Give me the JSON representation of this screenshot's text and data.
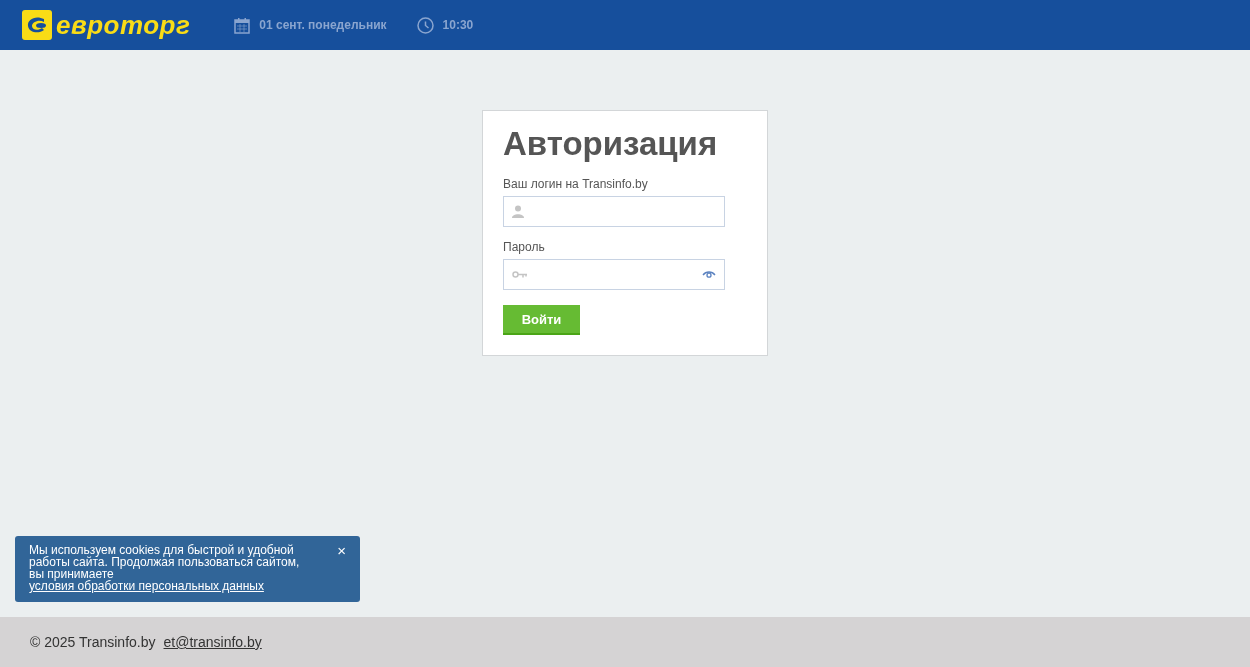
{
  "header": {
    "logo_text": "евроторг",
    "date": "01 сент. понедельник",
    "time": "10:30"
  },
  "login": {
    "title": "Авторизация",
    "fields": [
      {
        "kind": "login",
        "label": "Ваш логин на Transinfo.by"
      },
      {
        "kind": "password",
        "label": "Пароль"
      }
    ],
    "submit": "Войти"
  },
  "cookie_banner": {
    "text": "Мы используем cookies для быстрой и удобной работы сайта. Продолжая пользоваться сайтом, вы принимаете",
    "link": "условия обработки персональных данных",
    "close": "×"
  },
  "footer": {
    "copyright": "© 2025 Transinfo.by",
    "email": "et@transinfo.by"
  }
}
